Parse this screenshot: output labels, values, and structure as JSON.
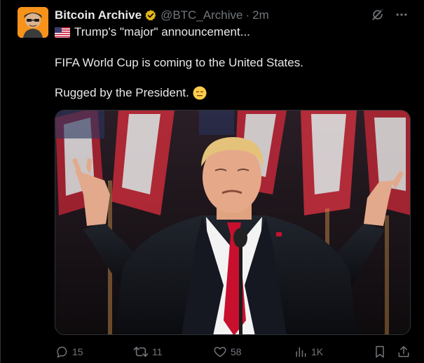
{
  "tweet": {
    "author": {
      "display_name": "Bitcoin Archive",
      "handle": "@BTC_Archive",
      "separator": "·",
      "time": "2m",
      "avatar_icon": "bitcoin-archive-avatar",
      "verified_icon": "gold-verified-badge-icon",
      "avatar_color": "#f7931a",
      "badge_color": "#e2b719"
    },
    "top_icons": [
      "grok-icon",
      "more-icon"
    ],
    "text": {
      "line1": "Trump's \"major\" announcement...",
      "line1_icon": "us-flag-icon",
      "line2": "FIFA World Cup is coming to the United States.",
      "line3": "Rugged by the President.",
      "line3_icon": "expressionless-face-icon"
    },
    "media": {
      "icon": "photo-of-man-shrugging-at-podium"
    },
    "actions": {
      "reply_count": "15",
      "repost_count": "11",
      "like_count": "58",
      "views_count": "1K",
      "reply_icon": "reply-icon",
      "repost_icon": "repost-icon",
      "like_icon": "heart-icon",
      "views_icon": "views-icon",
      "bookmark_icon": "bookmark-icon",
      "share_icon": "share-icon"
    },
    "colors": {
      "background": "#000000",
      "text": "#e7e9ea",
      "muted": "#71767b",
      "border": "#2f3336"
    }
  }
}
